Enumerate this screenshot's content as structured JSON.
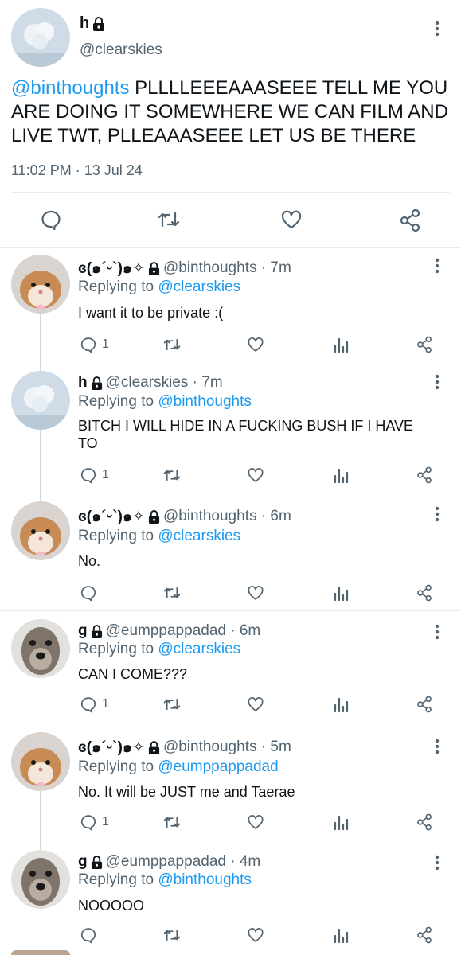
{
  "main": {
    "name": "h",
    "handle": "@clearskies",
    "mention": "@binthoughts",
    "text": " PLLLLEEEAAASEEE TELL ME YOU ARE DOING IT SOMEWHERE WE CAN FILM AND LIVE TWT, PLLEAAASEEE LET US BE THERE",
    "time": "11:02 PM · 13 Jul 24",
    "actions": [
      "reply-icon",
      "retweet-icon",
      "like-icon",
      "share-icon"
    ]
  },
  "replies": [
    {
      "name": "ɞ(๑´ᵕ`)๑✧",
      "handle": "@binthoughts",
      "time": "· 7m",
      "replying_label": "Replying to ",
      "replying_to": "@clearskies",
      "text": "I want it to be private :(",
      "reply_count": "1"
    },
    {
      "name": "h",
      "handle": "@clearskies",
      "time": "· 7m",
      "replying_label": "Replying to ",
      "replying_to": "@binthoughts",
      "text": "BITCH I WILL HIDE IN A FUCKING BUSH IF I HAVE TO",
      "reply_count": "1"
    },
    {
      "name": "ɞ(๑´ᵕ`)๑✧",
      "handle": "@binthoughts",
      "time": "· 6m",
      "replying_label": "Replying to ",
      "replying_to": "@clearskies",
      "text": "No.",
      "reply_count": ""
    },
    {
      "name": "g",
      "handle": "@eumppappadad",
      "time": "· 6m",
      "replying_label": "Replying to ",
      "replying_to": "@clearskies",
      "text": "CAN I COME???",
      "reply_count": "1"
    },
    {
      "name": "ɞ(๑´ᵕ`)๑✧",
      "handle": "@binthoughts",
      "time": "· 5m",
      "replying_label": "Replying to ",
      "replying_to": "@eumppappadad",
      "text": "No. It will be JUST me and Taerae",
      "reply_count": "1"
    },
    {
      "name": "g",
      "handle": "@eumppappadad",
      "time": "· 4m",
      "replying_label": "Replying to ",
      "replying_to": "@binthoughts",
      "text": "NOOOOO",
      "reply_count": ""
    }
  ],
  "colors": {
    "accent": "#1d9bf0",
    "muted": "#536471",
    "text": "#0f1419"
  },
  "reply_action_icons": [
    "reply-icon",
    "retweet-icon",
    "like-icon",
    "analytics-icon",
    "share-icon"
  ]
}
